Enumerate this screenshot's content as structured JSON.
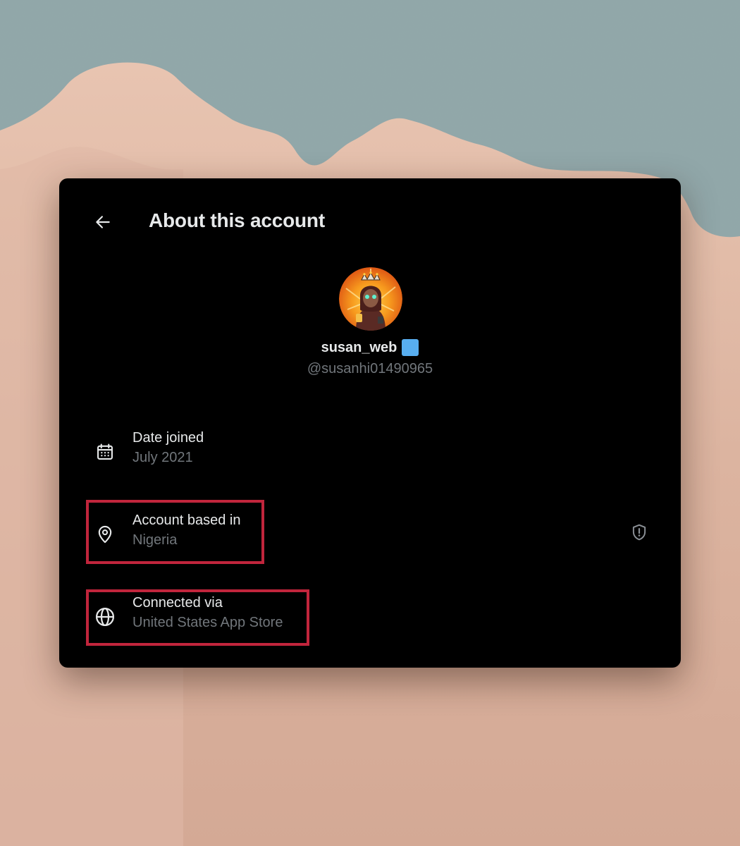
{
  "header": {
    "title": "About this account"
  },
  "profile": {
    "display_name": "susan_web",
    "handle": "@susanhi01490965"
  },
  "details": [
    {
      "label": "Date joined",
      "value": "July 2021",
      "icon": "calendar-icon"
    },
    {
      "label": "Account based in",
      "value": "Nigeria",
      "icon": "location-pin-icon"
    },
    {
      "label": "Connected via",
      "value": "United States App Store",
      "icon": "globe-icon"
    }
  ],
  "colors": {
    "card_background": "#000000",
    "primary_text": "#e7e9ea",
    "secondary_text": "#71767b",
    "verified_badge": "#58aef0",
    "highlight_border": "#c1253c"
  }
}
